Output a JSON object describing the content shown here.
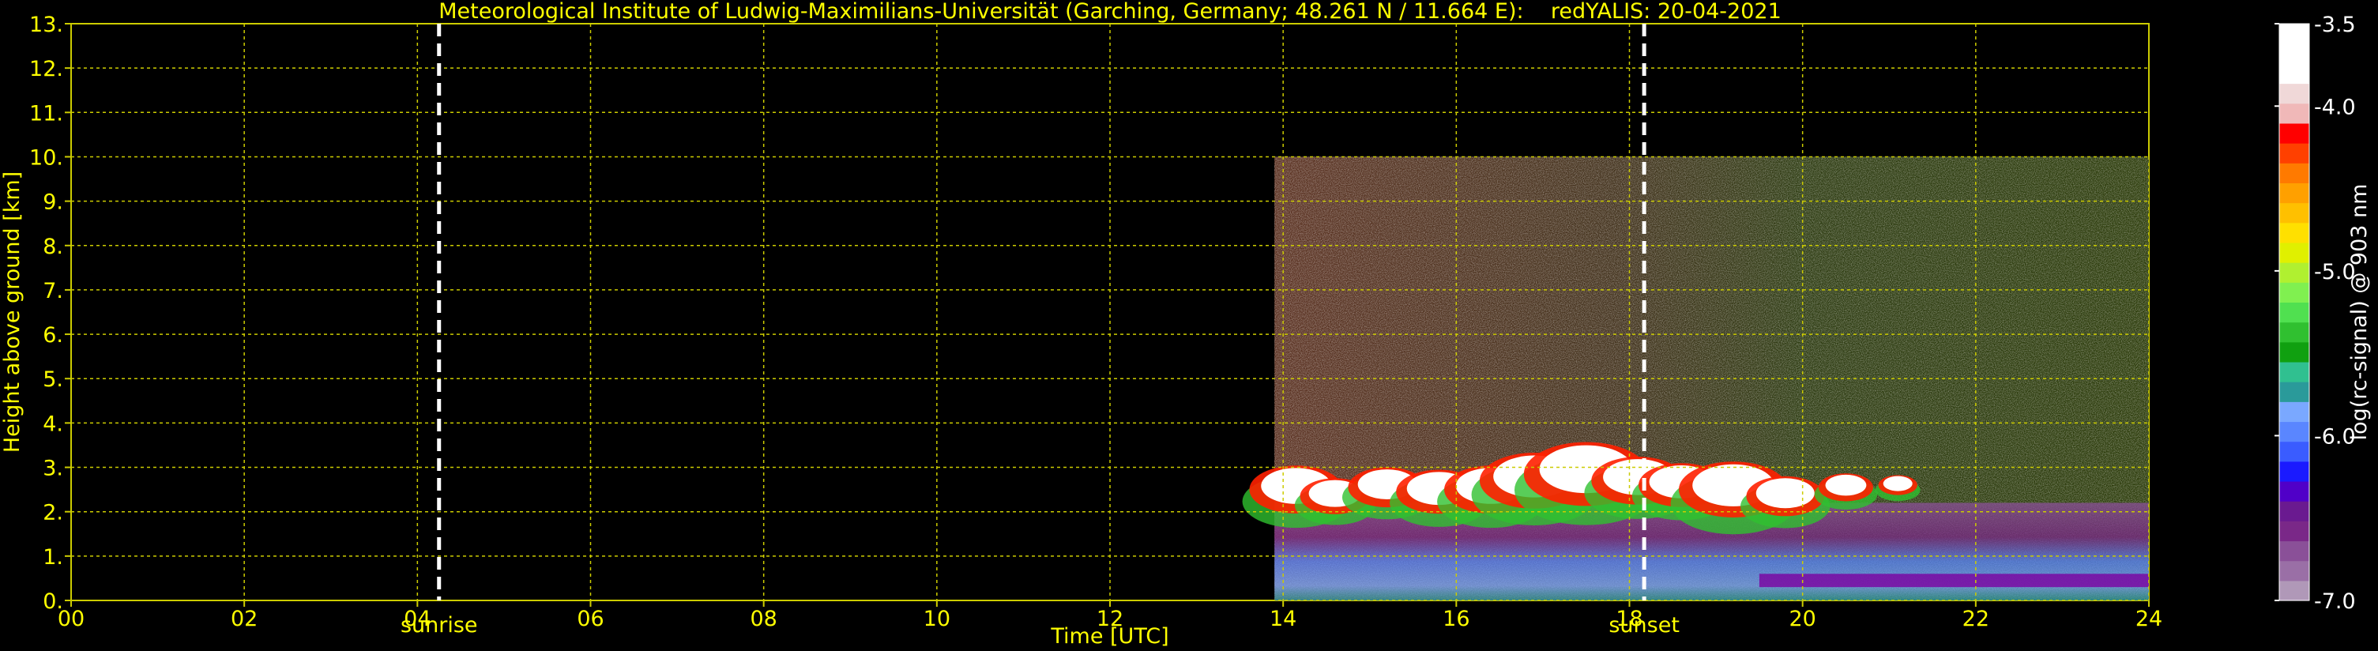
{
  "chart_data": {
    "type": "heatmap",
    "title": "Meteorological Institute of Ludwig-Maximilians-Universität (Garching, Germany; 48.261 N / 11.664 E):    redYALIS: 20-04-2021",
    "xlabel": "Time [UTC]",
    "ylabel": "Height above ground [km]",
    "xlim": [
      0,
      24
    ],
    "ylim": [
      0,
      13
    ],
    "xticks": [
      {
        "value": 0,
        "label": "00"
      },
      {
        "value": 2,
        "label": "02"
      },
      {
        "value": 4,
        "label": "04"
      },
      {
        "value": 6,
        "label": "06"
      },
      {
        "value": 8,
        "label": "08"
      },
      {
        "value": 10,
        "label": "10"
      },
      {
        "value": 12,
        "label": "12"
      },
      {
        "value": 14,
        "label": "14"
      },
      {
        "value": 16,
        "label": "16"
      },
      {
        "value": 18,
        "label": "18"
      },
      {
        "value": 20,
        "label": "20"
      },
      {
        "value": 22,
        "label": "22"
      },
      {
        "value": 24,
        "label": "24"
      }
    ],
    "yticks": [
      {
        "value": 0,
        "label": "0."
      },
      {
        "value": 1,
        "label": "1."
      },
      {
        "value": 2,
        "label": "2."
      },
      {
        "value": 3,
        "label": "3."
      },
      {
        "value": 4,
        "label": "4."
      },
      {
        "value": 5,
        "label": "5."
      },
      {
        "value": 6,
        "label": "6."
      },
      {
        "value": 7,
        "label": "7."
      },
      {
        "value": 8,
        "label": "8."
      },
      {
        "value": 9,
        "label": "9."
      },
      {
        "value": 10,
        "label": "10."
      },
      {
        "value": 11,
        "label": "11."
      },
      {
        "value": 12,
        "label": "12."
      },
      {
        "value": 13,
        "label": "13."
      }
    ],
    "grid": true,
    "markers": [
      {
        "name": "sunrise",
        "x": 4.25
      },
      {
        "name": "sunset",
        "x": 18.17
      }
    ],
    "data_coverage": {
      "x_start": 13.9,
      "x_end": 24,
      "y_max": 10
    },
    "cloud_layer": {
      "x_start": 14.0,
      "x_end": 21.4,
      "base_km": 1.7,
      "top_km": 3.7
    },
    "colorbar": {
      "label": "log(rc-signal) @ 903 nm",
      "range": [
        -7.0,
        -3.5
      ],
      "ticks": [
        {
          "value": -3.5,
          "label": "-3.5"
        },
        {
          "value": -4.0,
          "label": "-4.0"
        },
        {
          "value": -5.0,
          "label": "-5.0"
        },
        {
          "value": -6.0,
          "label": "-6.0"
        },
        {
          "value": -7.0,
          "label": "-7.0"
        }
      ],
      "colors": [
        "#b098b8",
        "#9a6fa6",
        "#8a5098",
        "#7a2888",
        "#6a1a90",
        "#5000c8",
        "#1a1aff",
        "#3a5cff",
        "#5a86ff",
        "#7aa8ff",
        "#2a9a9a",
        "#30c090",
        "#10a010",
        "#30c030",
        "#50e050",
        "#80f050",
        "#b0f030",
        "#e0f000",
        "#ffe000",
        "#ffc000",
        "#ffa000",
        "#ff7a00",
        "#ff4000",
        "#ff0000",
        "#f0b8b8",
        "#f0d8d8",
        "#ffffff",
        "#ffffff",
        "#ffffff"
      ],
      "colormap_accent": "#ffff00"
    }
  }
}
